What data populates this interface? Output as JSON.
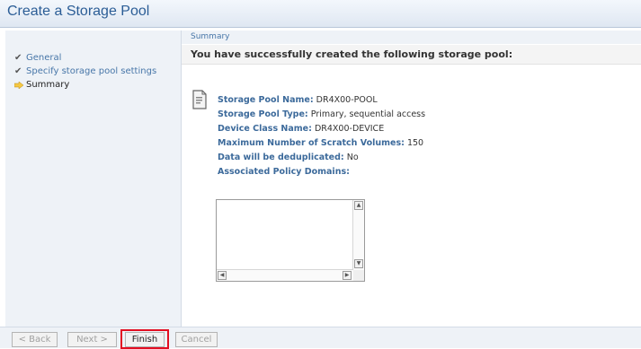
{
  "title": "Create a Storage Pool",
  "sidebar": {
    "steps": [
      {
        "label": "General"
      },
      {
        "label": "Specify storage pool settings"
      },
      {
        "label": "Summary"
      }
    ]
  },
  "main": {
    "section": "Summary",
    "message": "You have successfully created the following storage pool:",
    "details": [
      {
        "label": "Storage Pool Name:",
        "value": "DR4X00-POOL"
      },
      {
        "label": "Storage Pool Type:",
        "value": "Primary, sequential access"
      },
      {
        "label": "Device Class Name:",
        "value": "DR4X00-DEVICE"
      },
      {
        "label": "Maximum Number of Scratch Volumes:",
        "value": "150"
      },
      {
        "label": "Data will be deduplicated:",
        "value": "No"
      },
      {
        "label": "Associated Policy Domains:",
        "value": ""
      }
    ]
  },
  "footer": {
    "back": "< Back",
    "next": "Next >",
    "finish": "Finish",
    "cancel": "Cancel"
  },
  "colors": {
    "accent": "#2b5d96",
    "highlight": "#e20f22"
  }
}
